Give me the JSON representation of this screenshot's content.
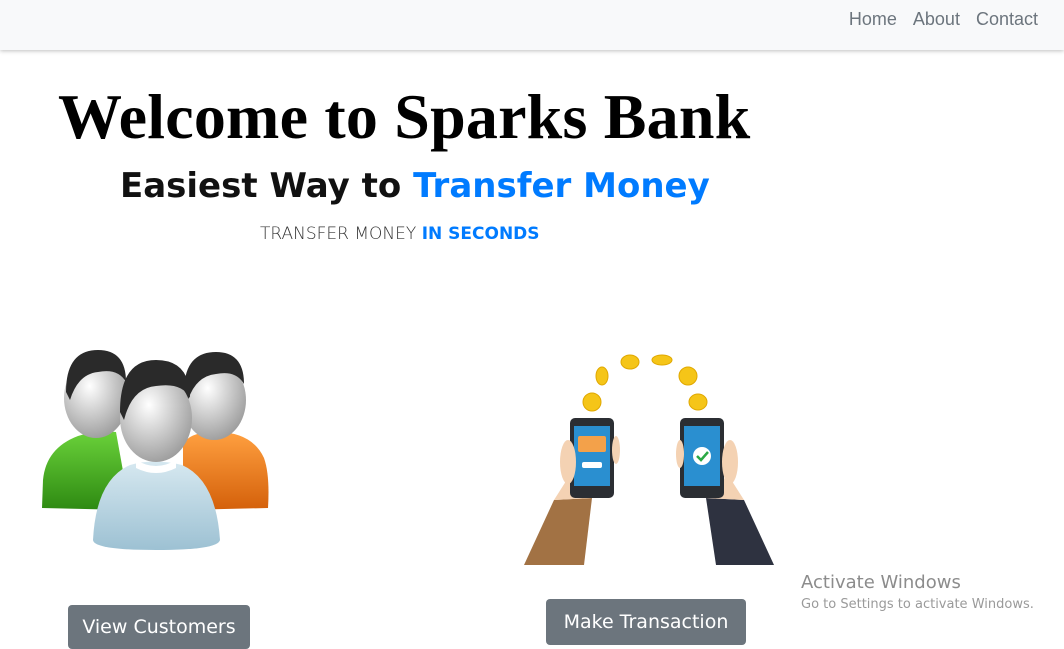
{
  "nav": {
    "items": [
      "Home",
      "About",
      "Contact"
    ]
  },
  "hero": {
    "title": "Welcome to Sparks Bank",
    "subtitle_plain": "Easiest Way to ",
    "subtitle_accent": "Transfer Money",
    "tagline_plain": "TRANSFER MONEY ",
    "tagline_accent": "IN SECONDS"
  },
  "buttons": {
    "view_customers": "View Customers",
    "make_transaction": "Make Transaction"
  },
  "watermark": {
    "title": "Activate Windows",
    "subtitle": "Go to Settings to activate Windows."
  },
  "colors": {
    "accent": "#007bff",
    "button": "#6c757d",
    "navbar": "#f8f9fa"
  },
  "icons": [
    "customers-illustration",
    "transaction-illustration"
  ]
}
